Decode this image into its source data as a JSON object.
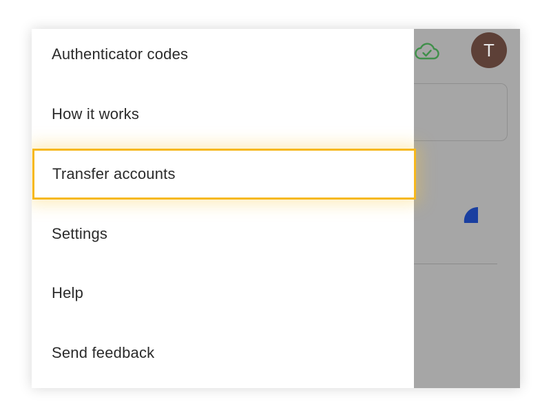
{
  "menu": {
    "items": [
      {
        "label": "Authenticator codes"
      },
      {
        "label": "How it works"
      },
      {
        "label": "Transfer accounts",
        "highlighted": true
      },
      {
        "label": "Settings"
      },
      {
        "label": "Help"
      },
      {
        "label": "Send feedback"
      }
    ]
  },
  "toolbar": {
    "sync_icon": "cloud-check-icon",
    "avatar_initial": "T"
  },
  "colors": {
    "highlight": "#f6b81c",
    "avatar": "#5d4037",
    "scrim": "#a6a6a6",
    "sync_icon": "#2e7d32",
    "progress": "#1a3fa0"
  }
}
